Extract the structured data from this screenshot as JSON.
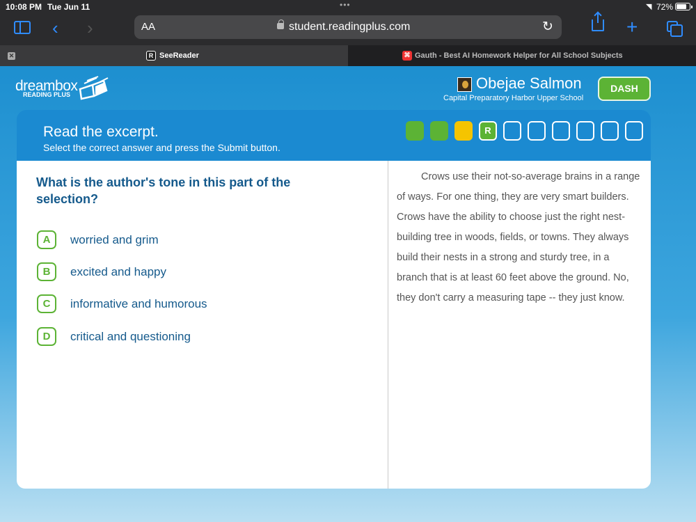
{
  "status_bar": {
    "time": "10:08 PM",
    "date": "Tue Jun 11",
    "battery": "72%"
  },
  "browser": {
    "text_size_label": "AA",
    "url": "student.readingplus.com",
    "tabs": [
      {
        "favicon": "R",
        "title": "SeeReader"
      },
      {
        "favicon": "G",
        "title": "Gauth - Best AI Homework Helper for All School Subjects"
      }
    ]
  },
  "header": {
    "logo_text": "dreambox",
    "logo_sub": "READING PLUS",
    "user_name": "Obejae Salmon",
    "school": "Capital Preparatory Harbor Upper School",
    "dash_label": "DASH"
  },
  "banner": {
    "title": "Read the excerpt.",
    "subtitle": "Select the correct answer and press the Submit button.",
    "progress": [
      {
        "state": "green",
        "label": ""
      },
      {
        "state": "green",
        "label": ""
      },
      {
        "state": "yellow",
        "label": ""
      },
      {
        "state": "review",
        "label": "R"
      },
      {
        "state": "empty",
        "label": ""
      },
      {
        "state": "empty",
        "label": ""
      },
      {
        "state": "empty",
        "label": ""
      },
      {
        "state": "empty",
        "label": ""
      },
      {
        "state": "empty",
        "label": ""
      },
      {
        "state": "empty",
        "label": ""
      }
    ]
  },
  "question": {
    "text": "What is the author's tone in this part of the selection?",
    "answers": [
      {
        "letter": "A",
        "text": "worried and grim"
      },
      {
        "letter": "B",
        "text": "excited and happy"
      },
      {
        "letter": "C",
        "text": "informative and humorous"
      },
      {
        "letter": "D",
        "text": "critical and questioning"
      }
    ]
  },
  "passage": {
    "text": "Crows use their not-so-average brains in a range of ways. For one thing, they are very smart builders. Crows have the ability to choose just the right nest-building tree in woods, fields, or towns. They always build their nests in a strong and sturdy tree, in a branch that is at least 60 feet above the ground. No, they don't carry a measuring tape -- they just know."
  },
  "colors": {
    "accent_green": "#5cb335",
    "accent_yellow": "#f5c400",
    "brand_blue": "#1b8ad1",
    "text_blue": "#155a8c"
  }
}
